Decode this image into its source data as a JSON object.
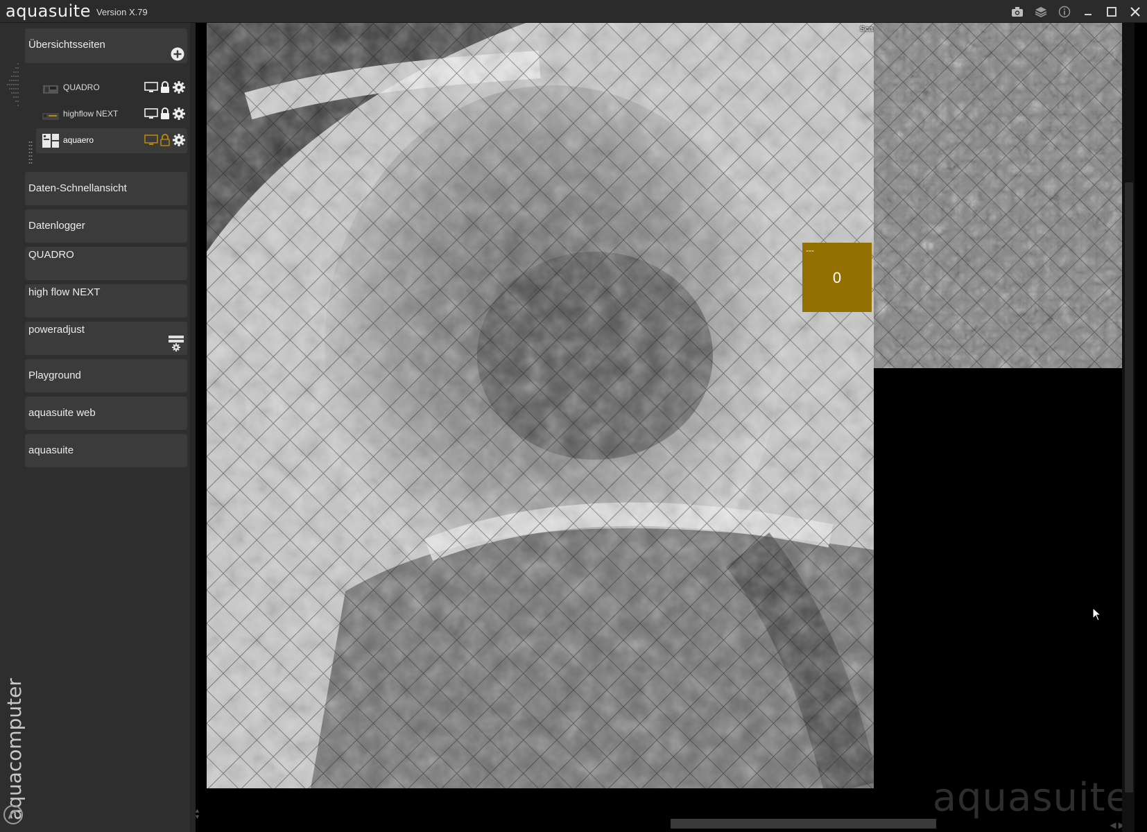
{
  "app": {
    "title": "aquasuite",
    "version": "Version X.79"
  },
  "titlebar_icons": [
    "camera-icon",
    "layers-icon",
    "info-icon",
    "minimize-icon",
    "maximize-icon",
    "close-icon"
  ],
  "sidebar": {
    "group_title": "Übersichtsseiten",
    "subitems": [
      {
        "label": "QUADRO",
        "active": false
      },
      {
        "label": "highflow NEXT",
        "active": false
      },
      {
        "label": "aquaero",
        "active": true
      }
    ],
    "items": [
      {
        "label": "Daten-Schnellansicht"
      },
      {
        "label": "Datenlogger"
      },
      {
        "label": "QUADRO"
      },
      {
        "label": "high flow NEXT"
      },
      {
        "label": "poweradjust"
      },
      {
        "label": "Playground"
      },
      {
        "label": "aquasuite web"
      },
      {
        "label": "aquasuite"
      }
    ],
    "brand": "aquacomputer"
  },
  "main": {
    "scanner_label": "Scanner",
    "tile": {
      "label": "---",
      "value": "0"
    },
    "watermark": "aquasuite"
  },
  "colors": {
    "accent": "#937000",
    "sidebar_bg": "#2e2e2e",
    "button_bg": "#3b3b3b",
    "active_icon": "#b8860b"
  }
}
